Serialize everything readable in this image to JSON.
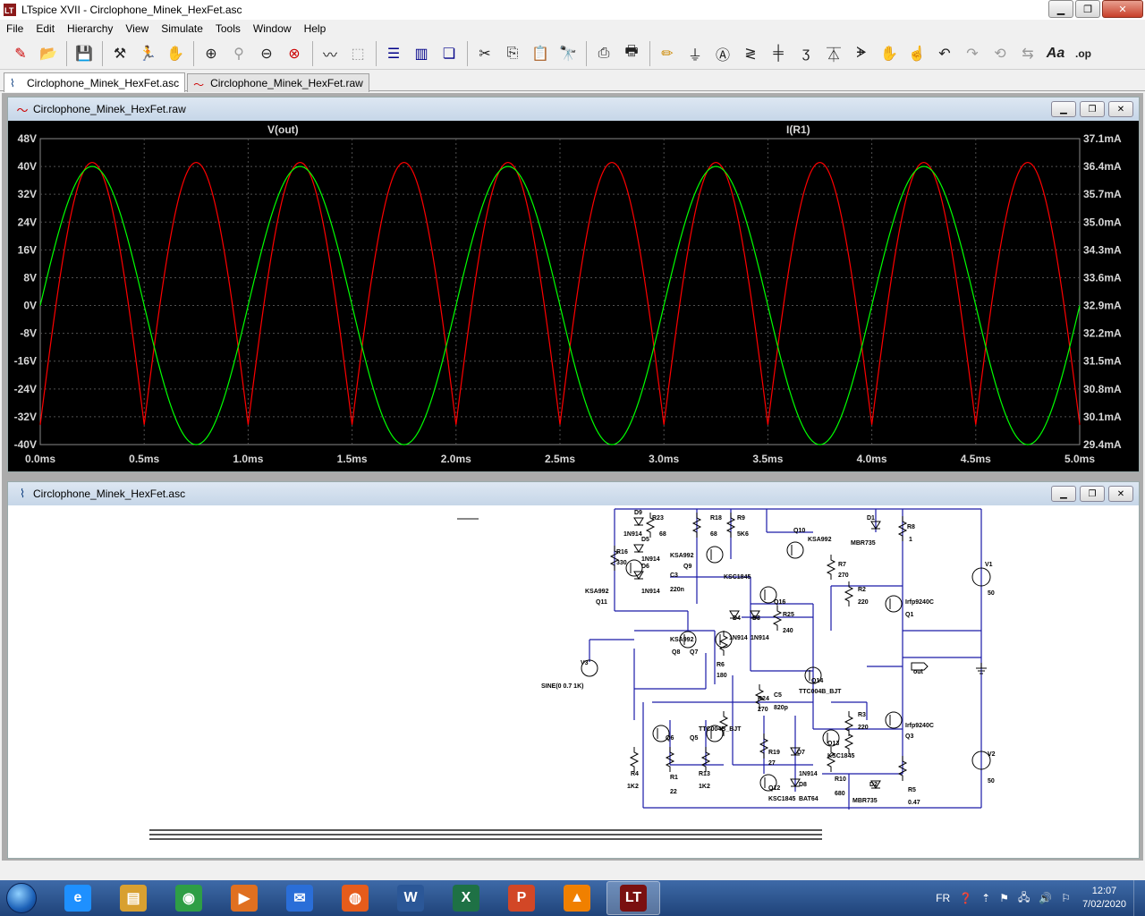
{
  "window": {
    "title": "LTspice XVII - Circlophone_Minek_HexFet.asc"
  },
  "menu": [
    "File",
    "Edit",
    "Hierarchy",
    "View",
    "Simulate",
    "Tools",
    "Window",
    "Help"
  ],
  "toolbar_icons": [
    "new-schematic-icon",
    "open-folder-icon",
    "save-icon",
    "control-panel-icon",
    "run-icon",
    "halt-icon",
    "zoom-in-icon",
    "pan-icon",
    "zoom-out-icon",
    "zoom-cancel-icon",
    "autorange-icon",
    "fit-icon",
    "tile-horizontal-icon",
    "tile-vertical-icon",
    "cascade-icon",
    "cut-icon",
    "copy-icon",
    "paste-icon",
    "find-icon",
    "print-icon",
    "print-setup-icon",
    "draw-wire-icon",
    "ground-icon",
    "label-net-icon",
    "resistor-icon",
    "capacitor-icon",
    "inductor-icon",
    "diode-icon",
    "component-icon",
    "move-icon",
    "drag-icon",
    "undo-icon",
    "redo-icon",
    "rotate-icon",
    "mirror-icon",
    "text-icon",
    "spice-directive-icon"
  ],
  "tabs": [
    {
      "label": "Circlophone_Minek_HexFet.asc",
      "icon": "schematic-icon",
      "active": true
    },
    {
      "label": "Circlophone_Minek_HexFet.raw",
      "icon": "waveform-icon",
      "active": false
    }
  ],
  "plot_window": {
    "title": "Circlophone_Minek_HexFet.raw",
    "traces": [
      {
        "name": "V(out)",
        "color": "#00ff00"
      },
      {
        "name": "I(R1)",
        "color": "#ff0000"
      }
    ]
  },
  "chart_data": {
    "type": "line",
    "x_ticks": [
      "0.0ms",
      "0.5ms",
      "1.0ms",
      "1.5ms",
      "2.0ms",
      "2.5ms",
      "3.0ms",
      "3.5ms",
      "4.0ms",
      "4.5ms",
      "5.0ms"
    ],
    "xlim_ms": [
      0,
      5
    ],
    "y_left_ticks": [
      "48V",
      "40V",
      "32V",
      "24V",
      "16V",
      "8V",
      "0V",
      "-8V",
      "-16V",
      "-24V",
      "-32V",
      "-40V"
    ],
    "ylim_left": [
      -40,
      48
    ],
    "y_right_ticks": [
      "37.1mA",
      "36.4mA",
      "35.7mA",
      "35.0mA",
      "34.3mA",
      "33.6mA",
      "32.9mA",
      "32.2mA",
      "31.5mA",
      "30.8mA",
      "30.1mA",
      "29.4mA"
    ],
    "ylim_right_mA": [
      29.4,
      37.1
    ],
    "grid": true,
    "series": [
      {
        "name": "V(out)",
        "color": "#00ff00",
        "axis": "left",
        "kind": "sine",
        "amplitude_V": 40,
        "offset_V": 0,
        "frequency_kHz": 1
      },
      {
        "name": "I(R1)",
        "color": "#ff0000",
        "axis": "right",
        "kind": "abs-sine",
        "min_mA": 29.9,
        "max_mA": 36.5,
        "frequency_kHz": 1
      }
    ]
  },
  "schematic_window": {
    "title": "Circlophone_Minek_HexFet.asc",
    "labels": [
      "D9",
      "1N914",
      "R23",
      "68",
      "R18",
      "68",
      "R9",
      "5K6",
      "Q10",
      "KSA992",
      "D1",
      "MBR735",
      "R8",
      "1",
      "D5",
      "1N914",
      "R16",
      "330",
      "KSA992",
      "Q9",
      "KSC1845",
      "R7",
      "270",
      "V1",
      "50",
      "D6",
      "1N914",
      "C3",
      "220n",
      "KSA992",
      "Q11",
      "Q16",
      "R2",
      "220",
      "Irfp9240C",
      "Q1",
      "D4",
      "D3",
      "R25",
      "240",
      "1N914",
      "1N914",
      "KSA992",
      "Q8",
      "Q7",
      "V3",
      "R6",
      "180",
      "SINE(0 0.7 1K)",
      "C5",
      "820p",
      "R24",
      "270",
      "Q14",
      "TTC004B_BJT",
      "out",
      "R3",
      "220",
      "Irfp9240C",
      "Q3",
      "Q5",
      "Q6",
      "TTC004B_BJT",
      "Q13",
      "KSC1845",
      "R19",
      "27",
      "D7",
      "1N914",
      "D8",
      "BAT64",
      "V2",
      "50",
      "R4",
      "1K2",
      "R1",
      "22",
      "R13",
      "1K2",
      "Q12",
      "KSC1845",
      "R10",
      "680",
      "D2",
      "MBR735",
      "R5",
      "0.47"
    ]
  },
  "taskbar": {
    "apps": [
      {
        "name": "internet-explorer",
        "glyph": "e",
        "color": "#1e90ff"
      },
      {
        "name": "file-explorer",
        "glyph": "▤",
        "color": "#d8a030"
      },
      {
        "name": "chrome",
        "glyph": "◉",
        "color": "#2e9e45"
      },
      {
        "name": "media-player",
        "glyph": "▶",
        "color": "#e07020"
      },
      {
        "name": "outlook",
        "glyph": "✉",
        "color": "#2a6ed8"
      },
      {
        "name": "firefox",
        "glyph": "◍",
        "color": "#e65c1b"
      },
      {
        "name": "word",
        "glyph": "W",
        "color": "#2b5797"
      },
      {
        "name": "excel",
        "glyph": "X",
        "color": "#1e7145"
      },
      {
        "name": "powerpoint",
        "glyph": "P",
        "color": "#d24726"
      },
      {
        "name": "vlc",
        "glyph": "▲",
        "color": "#f08000"
      },
      {
        "name": "ltspice",
        "glyph": "LT",
        "color": "#7a1010",
        "active": true
      }
    ],
    "lang": "FR",
    "time": "12:07",
    "date": "7/02/2020"
  }
}
